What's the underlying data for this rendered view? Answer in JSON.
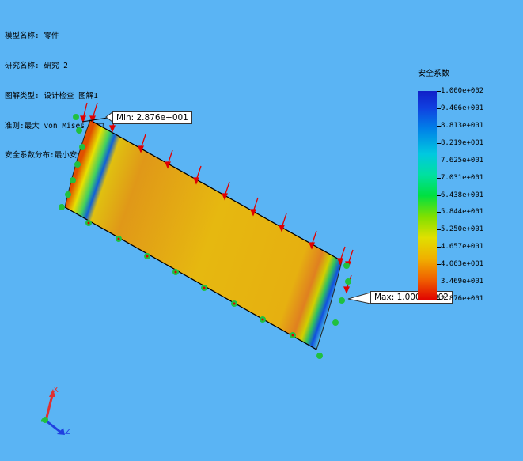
{
  "info": {
    "lines": [
      "模型名称: 零件",
      "研究名称: 研究 2",
      "图解类型: 设计检查 图解1",
      "准则:最大 von Mises 应力",
      "安全系数分布:最小安全系数 = 29"
    ]
  },
  "legend": {
    "title": "安全系数",
    "labels": [
      "1.000e+002",
      "9.406e+001",
      "8.813e+001",
      "8.219e+001",
      "7.625e+001",
      "7.031e+001",
      "6.438e+001",
      "5.844e+001",
      "5.250e+001",
      "4.657e+001",
      "4.063e+001",
      "3.469e+001",
      "2.876e+001"
    ]
  },
  "callouts": {
    "min": "Min: 2.876e+001",
    "max": "Max: 1.000e+002"
  },
  "triad": {
    "x": "X",
    "z": "Z"
  },
  "colors": {
    "background": "#5ab4f4",
    "part_fill": "#e8b010",
    "load_arrow": "#e00000",
    "fixture": "#20c040"
  }
}
